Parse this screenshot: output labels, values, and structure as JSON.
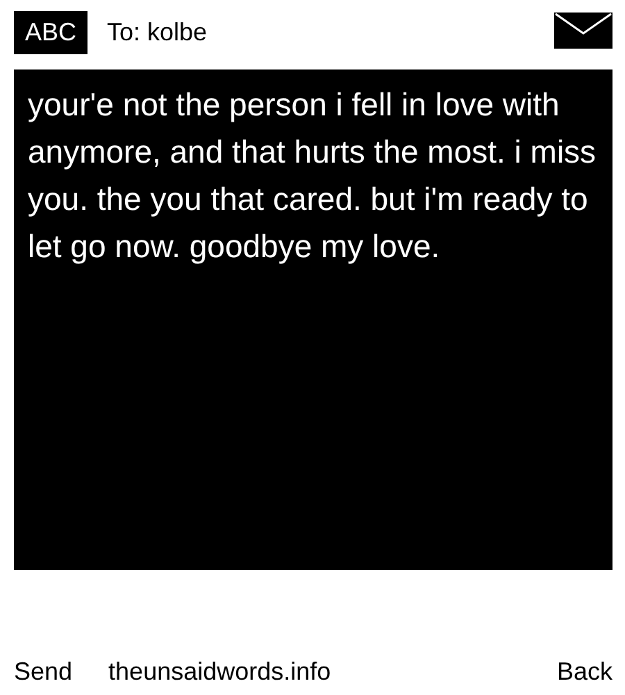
{
  "header": {
    "mode_label": "ABC",
    "recipient": "To: kolbe"
  },
  "message": {
    "text": "your'e not the person i fell in love with anymore, and that hurts the most. i miss you. the you that cared. but i'm ready to let go now. goodbye my love."
  },
  "footer": {
    "send": "Send",
    "site": "theunsaidwords.info",
    "back": "Back"
  }
}
